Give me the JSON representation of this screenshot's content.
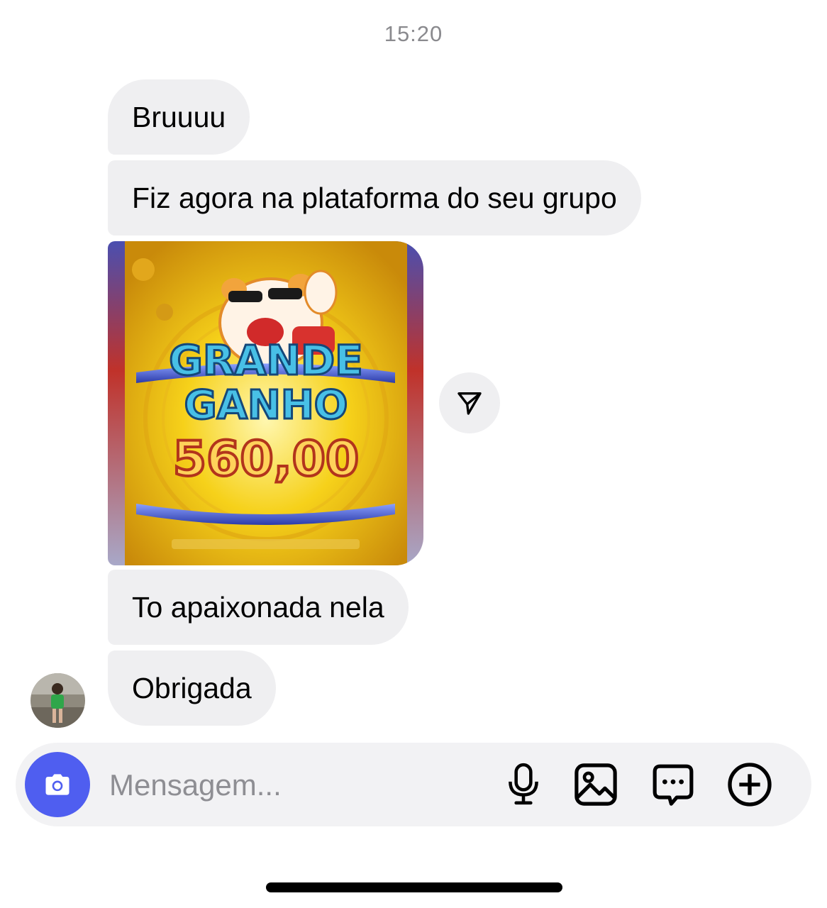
{
  "chat": {
    "timestamp": "15:20",
    "messages": [
      {
        "text": "Bruuuu"
      },
      {
        "text": "Fiz agora na plataforma do seu grupo"
      },
      {
        "type": "image",
        "text_line1": "GRANDE",
        "text_line2": "GANHO",
        "amount": "560,00"
      },
      {
        "text": "To apaixonada nela"
      },
      {
        "text": "Obrigada"
      }
    ]
  },
  "composer": {
    "placeholder": "Mensagem..."
  },
  "colors": {
    "bubble": "#efeff1",
    "camera_button": "#4f5ef0",
    "composer_bg": "#f2f2f4"
  },
  "icons": [
    "send-icon",
    "camera-icon",
    "microphone-icon",
    "gallery-icon",
    "sticker-icon",
    "plus-circle-icon"
  ]
}
